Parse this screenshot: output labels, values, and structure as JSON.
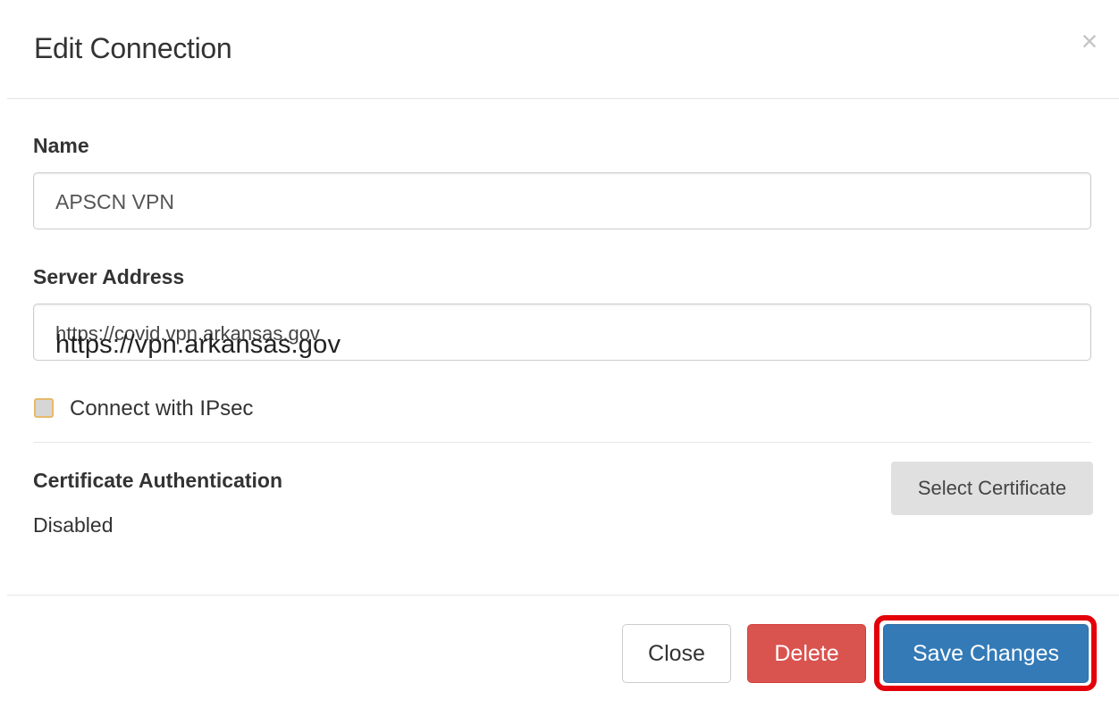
{
  "dialog": {
    "title": "Edit Connection",
    "close_icon": "close-icon",
    "close_glyph": "×"
  },
  "form": {
    "name": {
      "label": "Name",
      "value": "APSCN VPN"
    },
    "server_address": {
      "label": "Server Address",
      "struck_value": "https://covid.vpn.arkansas.gov",
      "overlay_value": "https://vpn.arkansas.gov"
    },
    "ipsec": {
      "label": "Connect with IPsec",
      "checked": false
    },
    "certificate": {
      "label": "Certificate Authentication",
      "status": "Disabled",
      "select_button": "Select Certificate"
    }
  },
  "footer": {
    "close_button": "Close",
    "delete_button": "Delete",
    "save_button": "Save Changes"
  },
  "colors": {
    "primary": "#337ab7",
    "danger": "#d9534f",
    "highlight": "#e3000b"
  }
}
